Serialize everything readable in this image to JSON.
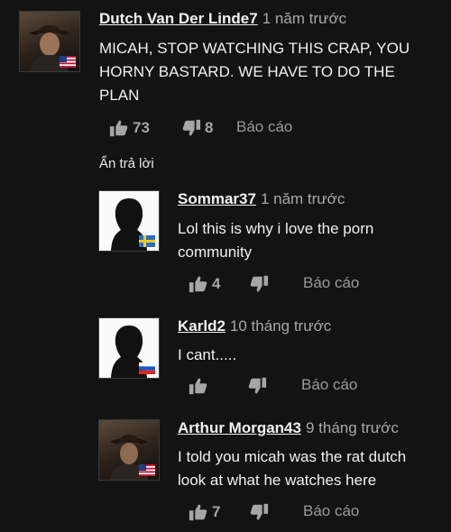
{
  "comments": [
    {
      "author": "Dutch Van Der Linde7",
      "time": "1 năm trước",
      "text": "MICAH, STOP WATCHING THIS CRAP, YOU HORNY BASTARD. WE HAVE TO DO THE PLAN",
      "likes": "73",
      "dislikes": "8",
      "report": "Báo cáo",
      "avatar_type": "photo",
      "flag": "us"
    }
  ],
  "hide_replies": "Ẩn trả lời",
  "replies": [
    {
      "author": "Sommar37",
      "time": "1 năm trước",
      "text": "Lol this is why i love the porn community",
      "likes": "4",
      "dislikes": "",
      "report": "Báo cáo",
      "avatar_type": "blank",
      "flag": "se"
    },
    {
      "author": "Karld2",
      "time": "10 tháng trước",
      "text": "I cant.....",
      "likes": "",
      "dislikes": "",
      "report": "Báo cáo",
      "avatar_type": "blank",
      "flag": "ru"
    },
    {
      "author": "Arthur Morgan43",
      "time": "9 tháng trước",
      "text": "I told you micah was the rat dutch look at what he watches here",
      "likes": "7",
      "dislikes": "",
      "report": "Báo cáo",
      "avatar_type": "photo",
      "flag": "us"
    }
  ],
  "icons": {
    "like": "thumbs-up-icon",
    "dislike": "thumbs-down-icon"
  },
  "colors": {
    "background": "#131313",
    "text": "#f0f0f0",
    "muted": "#9a9a9a"
  }
}
